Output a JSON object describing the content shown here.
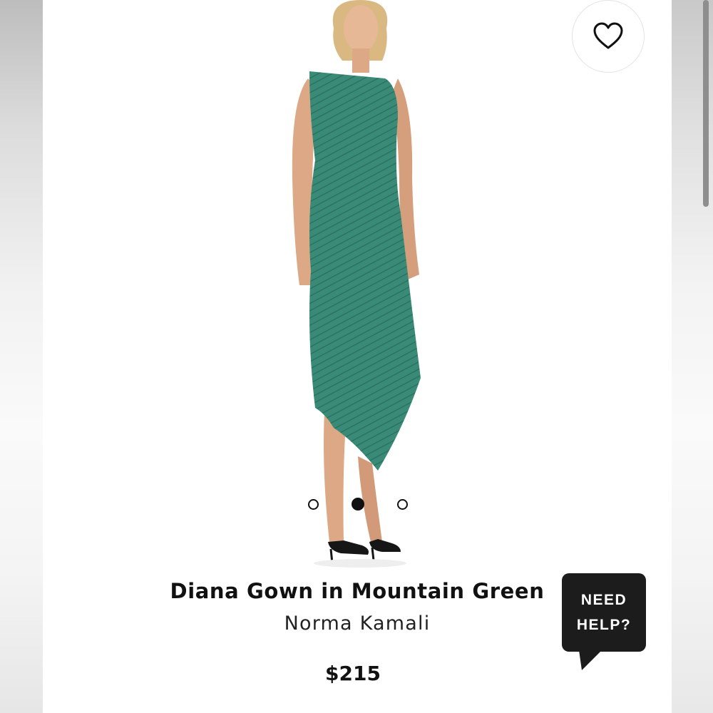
{
  "colors": {
    "dress": "#3a8a78",
    "help_bubble": "#1c1c1c",
    "text": "#111111"
  },
  "icons": {
    "wishlist": "heart-icon"
  },
  "gallery": {
    "image_count": 3,
    "active_index": 1
  },
  "product": {
    "title": "Diana Gown in Mountain Green",
    "brand": "Norma Kamali",
    "price": "$215"
  },
  "help": {
    "line1": "NEED",
    "line2": "HELP?"
  }
}
